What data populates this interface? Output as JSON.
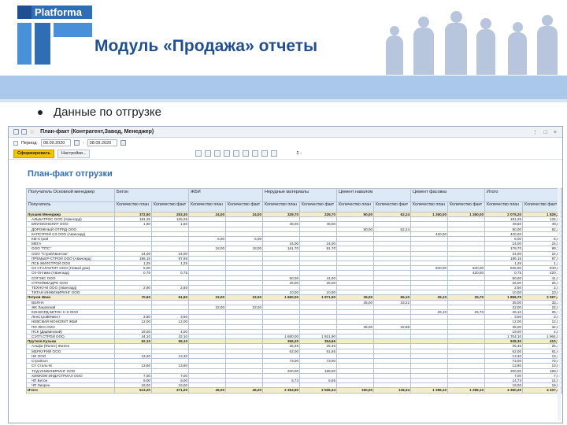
{
  "logo": {
    "text": "Platforma"
  },
  "slide": {
    "title": "Модуль «Продажа» отчеты",
    "bullet": "Данные по отгрузке"
  },
  "window": {
    "title": "План-факт (Контрагент,Завод, Менеджер)",
    "controls": "⋮ □ ×",
    "period_label": "Период:",
    "date_from": "08.09.2020",
    "date_sep": "-",
    "date_to": "08.09.2020",
    "generate_button": "Сформировать",
    "settings_button": "Настройки...",
    "sum_label": "Σ -"
  },
  "report": {
    "title": "План-факт отгрузки",
    "header_group_label": "Получатель Основной менеджер",
    "header_recipient_label": "Получатель",
    "groups": [
      "Бетон",
      "ЖБИ",
      "Нерудные материалы",
      "Цемент навалом",
      "Цемент фасовка",
      "Итого"
    ],
    "sub_plan": "Количество план",
    "sub_fact": "Количество факт",
    "rows": [
      {
        "type": "grp",
        "name": "Лучшев Менеджер",
        "v": [
          "372,50",
          "253,30",
          "24,00",
          "24,00",
          "329,70",
          "229,70",
          "90,00",
          "62,24",
          "1 260,00",
          "1 260,00",
          "2 075,20",
          "1 829,24"
        ]
      },
      {
        "type": "row",
        "name": "АЛЬБАТРОС ООО (Авангард)",
        "v": [
          "181,25",
          "125,25",
          "",
          "",
          "",
          "",
          "",
          "",
          "",
          "",
          "181,25",
          "125,25"
        ]
      },
      {
        "type": "row",
        "name": "БФИ-МОНОЛИТ ООО",
        "v": [
          "1,60",
          "1,60",
          "",
          "",
          "48,00",
          "48,00",
          "",
          "",
          "",
          "",
          "49,60",
          "49,60"
        ]
      },
      {
        "type": "row",
        "name": "ДОРОЖНЫЙ ОТРЯД ООО",
        "v": [
          "",
          "",
          "",
          "",
          "",
          "",
          "90,00",
          "62,24",
          "",
          "",
          "90,00",
          "62,24"
        ]
      },
      {
        "type": "row",
        "name": "КАПСТРОЙ СЗ ООО (Авангард)",
        "v": [
          "",
          "",
          "",
          "",
          "",
          "",
          "",
          "",
          "420,00",
          "",
          "420,00",
          ""
        ]
      },
      {
        "type": "row",
        "name": "КМ-Строй",
        "v": [
          "",
          "",
          "6,00",
          "6,00",
          "",
          "",
          "",
          "",
          "",
          "",
          "6,00",
          "6,00"
        ]
      },
      {
        "type": "row",
        "name": "МЕГА",
        "v": [
          "",
          "",
          "",
          "",
          "24,00",
          "24,00",
          "",
          "",
          "",
          "",
          "24,00",
          "24,00"
        ]
      },
      {
        "type": "row",
        "name": "ООО \"ПТС\"",
        "v": [
          "",
          "",
          "18,00",
          "18,00",
          "161,70",
          "81,70",
          "",
          "",
          "",
          "",
          "179,70",
          "99,70"
        ]
      },
      {
        "type": "row",
        "name": "ООО \"СтройАвантаж\"",
        "v": [
          "24,00",
          "24,00",
          "",
          "",
          "",
          "",
          "",
          "",
          "",
          "",
          "24,00",
          "24,00"
        ]
      },
      {
        "type": "row",
        "name": "ПРЕМЬЕР-СТРОЙ ООО (Авангард)",
        "v": [
          "186,15",
          "97,95",
          "",
          "",
          "",
          "",
          "",
          "",
          "",
          "",
          "186,15",
          "97,95"
        ]
      },
      {
        "type": "row",
        "name": "ПСБ ЖИЛСТРОЙ ООО",
        "v": [
          "1,25",
          "1,25",
          "",
          "",
          "",
          "",
          "",
          "",
          "",
          "",
          "1,25",
          "1,25"
        ]
      },
      {
        "type": "row",
        "name": "СК СТАЛАКТИТ ООО (Новый дом)",
        "v": [
          "5,00",
          "",
          "",
          "",
          "",
          "",
          "",
          "",
          "840,00",
          "840,00",
          "845,00",
          "840,00"
        ]
      },
      {
        "type": "row",
        "name": "СК-Оптима (Авангард)",
        "v": [
          "0,75",
          "0,75",
          "",
          "",
          "",
          "",
          "",
          "",
          "",
          "420,00",
          "0,75",
          "420,75"
        ]
      },
      {
        "type": "row",
        "name": "СОГЭКС ООО",
        "v": [
          "",
          "",
          "",
          "",
          "50,00",
          "41,00",
          "",
          "",
          "",
          "",
          "50,00",
          "41,00"
        ]
      },
      {
        "type": "row",
        "name": "СТРОЙКВАДРО ООО",
        "v": [
          "",
          "",
          "",
          "",
          "25,00",
          "25,00",
          "",
          "",
          "",
          "",
          "25,00",
          "25,00"
        ]
      },
      {
        "type": "row",
        "name": "ТЕХНО-М ООО (Авангард)",
        "v": [
          "2,50",
          "2,50",
          "",
          "",
          "",
          "",
          "",
          "",
          "",
          "",
          "2,50",
          "2,50"
        ]
      },
      {
        "type": "row",
        "name": "ТИТАН ИНЖИНИРИНГ ООО",
        "v": [
          "",
          "",
          "",
          "",
          "10,00",
          "10,00",
          "",
          "",
          "",
          "",
          "10,00",
          "10,00"
        ]
      },
      {
        "type": "grp",
        "name": "Петров Иван",
        "v": [
          "70,60",
          "61,60",
          "22,00",
          "22,00",
          "1 660,00",
          "1 971,90",
          "35,00",
          "66,10",
          "26,10",
          "25,70",
          "1 856,70",
          "2 097,46"
        ]
      },
      {
        "type": "row",
        "name": "ВОЛНА",
        "v": [
          "",
          "",
          "",
          "",
          "",
          "",
          "35,00",
          "33,22",
          "",
          "",
          "35,00",
          "33,22"
        ]
      },
      {
        "type": "row",
        "name": "ЖК Лаковский",
        "v": [
          "",
          "",
          "22,00",
          "22,00",
          "",
          "",
          "",
          "",
          "",
          "",
          "22,00",
          "22,00"
        ]
      },
      {
        "type": "row",
        "name": "КОНКОРД БЕТОН С-З ООО",
        "v": [
          "",
          "",
          "",
          "",
          "",
          "",
          "",
          "",
          "26,10",
          "25,70",
          "26,10",
          "25,70"
        ]
      },
      {
        "type": "row",
        "name": "ЛенСтройИнвест",
        "v": [
          "3,50",
          "3,50",
          "",
          "",
          "",
          "",
          "",
          "",
          "",
          "",
          "3,50",
          "3,50"
        ]
      },
      {
        "type": "row",
        "name": "НЕВСКИЙ МОНОЛИТ ЖБИ",
        "v": [
          "12,00",
          "12,00",
          "",
          "",
          "",
          "",
          "",
          "",
          "",
          "",
          "12,00",
          "12,00"
        ]
      },
      {
        "type": "row",
        "name": "ПО ЛЕО ООО",
        "v": [
          "",
          "",
          "",
          "",
          "",
          "",
          "35,00",
          "32,88",
          "",
          "",
          "35,00",
          "32,88"
        ]
      },
      {
        "type": "row",
        "name": "ПСК (Дарвинский)",
        "v": [
          "19,00",
          "4,00",
          "",
          "",
          "",
          "",
          "",
          "",
          "",
          "",
          "19,00",
          "4,00"
        ]
      },
      {
        "type": "row",
        "name": "СЭТП СТРОЙ ООО",
        "v": [
          "44,10",
          "42,10",
          "",
          "",
          "1 660,00",
          "1 921,90",
          "",
          "",
          "",
          "",
          "1 704,10",
          "1 964,00"
        ]
      },
      {
        "type": "grp",
        "name": "Прутков Кузьма",
        "v": [
          "62,10",
          "56,10",
          "",
          "",
          "366,20",
          "354,66",
          "",
          "",
          "",
          "",
          "628,30",
          "410,76"
        ]
      },
      {
        "type": "row",
        "name": "Альфа (Фалес) Жилен",
        "v": [
          "",
          "",
          "",
          "",
          "25,46",
          "25,46",
          "",
          "",
          "",
          "",
          "25,46",
          "25,46"
        ]
      },
      {
        "type": "row",
        "name": "МЕРКУРИЙ ООО",
        "v": [
          "",
          "",
          "",
          "",
          "62,00",
          "61,65",
          "",
          "",
          "",
          "",
          "62,00",
          "61,65"
        ]
      },
      {
        "type": "row",
        "name": "НЕ ООО",
        "v": [
          "13,30",
          "13,30",
          "",
          "",
          "",
          "",
          "",
          "",
          "",
          "",
          "13,30",
          "13,30"
        ]
      },
      {
        "type": "row",
        "name": "Стройсил",
        "v": [
          "",
          "",
          "",
          "",
          "73,00",
          "73,00",
          "",
          "",
          "",
          "",
          "73,00",
          "73,00"
        ]
      },
      {
        "type": "row",
        "name": "СУ Сталь-М",
        "v": [
          "13,80",
          "13,80",
          "",
          "",
          "",
          "",
          "",
          "",
          "",
          "",
          "13,80",
          "13,80"
        ]
      },
      {
        "type": "row",
        "name": "ТСД ИНЖИНИРИНГ ООО",
        "v": [
          "",
          "",
          "",
          "",
          "200,00",
          "189,00",
          "",
          "",
          "",
          "",
          "200,00",
          "189,00"
        ]
      },
      {
        "type": "row",
        "name": "ХИМКОМ ИНДУСТРИАЛ ООО",
        "v": [
          "7,00",
          "7,00",
          "",
          "",
          "",
          "",
          "",
          "",
          "",
          "",
          "7,00",
          "7,00"
        ]
      },
      {
        "type": "row",
        "name": "ЧП Бетон",
        "v": [
          "9,00",
          "9,00",
          "",
          "",
          "5,74",
          "5,55",
          "",
          "",
          "",
          "",
          "14,74",
          "14,55"
        ]
      },
      {
        "type": "row",
        "name": "ЧП Лиорен",
        "v": [
          "19,00",
          "19,00",
          "",
          "",
          "",
          "",
          "",
          "",
          "",
          "",
          "19,00",
          "19,00"
        ]
      },
      {
        "type": "tot",
        "name": "Итого",
        "v": [
          "513,20",
          "371,00",
          "46,00",
          "46,00",
          "2 354,90",
          "2 506,34",
          "160,00",
          "128,34",
          "1 286,10",
          "1 286,10",
          "4 360,20",
          "4 337,46"
        ]
      }
    ]
  }
}
